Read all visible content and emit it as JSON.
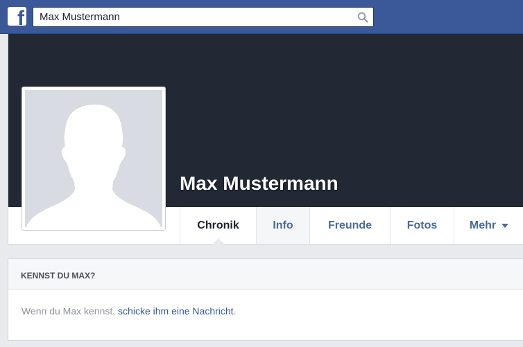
{
  "header": {
    "logo_letter": "f",
    "search": {
      "value": "Max Mustermann"
    }
  },
  "profile": {
    "name": "Max Mustermann"
  },
  "tabs": [
    {
      "label": "Chronik"
    },
    {
      "label": "Info"
    },
    {
      "label": "Freunde"
    },
    {
      "label": "Fotos"
    },
    {
      "label": "Mehr"
    }
  ],
  "know_box": {
    "title": "KENNST DU MAX?",
    "text_prefix": "Wenn du Max kennst, ",
    "link_text": "schicke ihm eine Nachricht",
    "text_suffix": "."
  },
  "colors": {
    "brand": "#3b5998",
    "cover": "#232835",
    "link": "#365899"
  }
}
